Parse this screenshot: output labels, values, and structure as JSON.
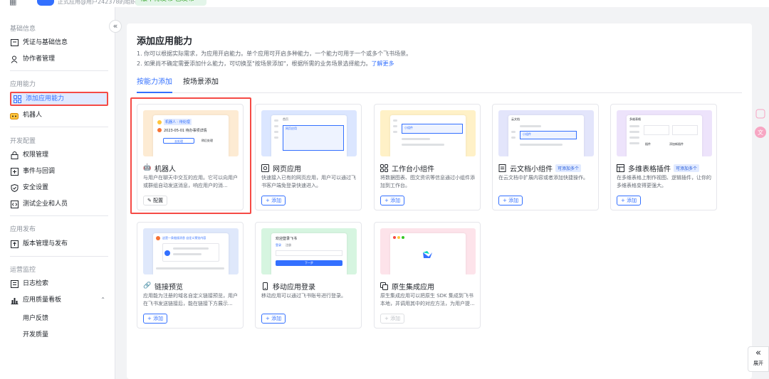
{
  "topbar": {
    "org": "正式应用@用户242378的组织",
    "status": "版本待发布 已发布"
  },
  "sidebar": {
    "collapse_icon": "«",
    "groups": [
      {
        "label": "基础信息",
        "items": [
          "凭证与基础信息",
          "协作者管理"
        ]
      },
      {
        "label": "应用能力",
        "items": [
          "添加应用能力",
          "机器人"
        ]
      },
      {
        "label": "开发配置",
        "items": [
          "权限管理",
          "事件与回调",
          "安全设置",
          "测试企业和人员"
        ]
      },
      {
        "label": "应用发布",
        "items": [
          "版本管理与发布"
        ]
      },
      {
        "label": "运营监控",
        "items": [
          "日志检索",
          "应用质量看板"
        ],
        "subitems": [
          "用户反馈",
          "开发质量"
        ]
      }
    ]
  },
  "main": {
    "title": "添加应用能力",
    "desc1": "1. 你可以根据实际需求，为应用开启能力。单个应用可开启多种能力，一个能力可用于一个或多个飞书场景。",
    "desc2": "2. 如果尚不确定需要添加什么能力，可切换至\"按场景添加\"，根据所需的业务场景选择能力。",
    "learn_more": "了解更多",
    "tabs": [
      "按能力添加",
      "按场景添加"
    ]
  },
  "cards": [
    {
      "name": "机器人",
      "desc": "与用户在聊天中交互的应用。它可以向用户或群组自动发送消息，响应用户的消...",
      "button": "✎ 配置",
      "icon": "robot-icon",
      "accent": "#fdebd3",
      "tag": ""
    },
    {
      "name": "网页应用",
      "desc": "快速接入已有的网页应用，用户可以通过飞书客户端免登录快速进入。",
      "button": "+ 添加",
      "icon": "web-icon",
      "accent": "#dbe6ff",
      "tag": ""
    },
    {
      "name": "工作台小组件",
      "desc": "将数据图表、图文资讯等信息通过小组件添加到工作台。",
      "button": "+ 添加",
      "icon": "widget-icon",
      "accent": "#fff1c7",
      "tag": ""
    },
    {
      "name": "云文档小组件",
      "desc": "在云文档中扩展内容或者添加快捷操作。",
      "button": "+ 添加",
      "icon": "doc-icon",
      "accent": "#e3e5fb",
      "tag": "可添加多个"
    },
    {
      "name": "多维表格插件",
      "desc": "在多维表格上制作视图、逻辑插件，让你的多维表格变得更强大。",
      "button": "+ 添加",
      "icon": "table-icon",
      "accent": "#ede3fb",
      "tag": "可添加多个"
    },
    {
      "name": "链接预览",
      "desc": "应用能为注册的域名自定义链接预览，用户在飞书发送链接后，能在链接下方展示...",
      "button": "+ 添加",
      "icon": "link-icon",
      "accent": "#dfe8fb",
      "tag": ""
    },
    {
      "name": "移动应用登录",
      "desc": "移动应用可以通过飞书账号进行登录。",
      "button": "+ 添加",
      "icon": "mobile-icon",
      "accent": "#d6f5e0",
      "tag": ""
    },
    {
      "name": "原生集成应用",
      "desc": "原生集成应用可以把原生 SDK 集成到飞书本地，并调用其中的对应方法，为用户提...",
      "button": "+ 添加",
      "icon": "native-icon",
      "accent": "#fde3ea",
      "tag": ""
    }
  ],
  "previews": {
    "bot": {
      "chip": "机器人 · 待处理",
      "line": "2023-05-01 待办事项详情",
      "btn": "去处理",
      "btn2": "稍后处理"
    },
    "web": {
      "tab": "首页",
      "box": "网页应用"
    },
    "widget": {
      "box": "小组件"
    },
    "doc": {
      "header": "云文档",
      "box": "小组件"
    },
    "table": {
      "header": "多维表格",
      "btn": "插件",
      "btn2": "添加新插件"
    },
    "link": {
      "text": "这是一条链接消息 自定义预览内容"
    },
    "mobile": {
      "header": "欢迎登录飞书",
      "tab1": "登录",
      "tab2": "注册",
      "btn": "下一步"
    }
  },
  "expand": {
    "label": "展开",
    "icon": "double-chevron-left-icon"
  }
}
